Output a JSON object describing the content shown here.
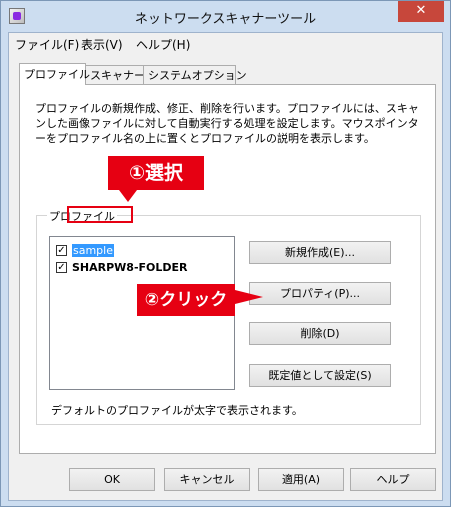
{
  "window": {
    "title": "ネットワークスキャナーツール",
    "close_label": "✕"
  },
  "menu": [
    "ファイル(F)",
    "表示(V)",
    "ヘルプ(H)"
  ],
  "tabs": [
    "プロファイル",
    "スキャナー",
    "システムオプション"
  ],
  "description": "プロファイルの新規作成、修正、削除を行います。プロファイルには、スキャンした画像ファイルに対して自動実行する処理を設定します。マウスポインターをプロファイル名の上に置くとプロファイルの説明を表示します。",
  "profile_group": {
    "label": "プロファイル",
    "items": [
      {
        "name": "sample",
        "checked": true,
        "selected": true,
        "bold": false
      },
      {
        "name": "SHARPW8-FOLDER",
        "checked": true,
        "selected": false,
        "bold": true
      }
    ],
    "buttons": {
      "new": "新規作成(E)...",
      "properties": "プロパティ(P)...",
      "delete": "削除(D)",
      "set_default": "既定値として設定(S)"
    },
    "footnote": "デフォルトのプロファイルが太字で表示されます。"
  },
  "dialog_buttons": {
    "ok": "OK",
    "cancel": "キャンセル",
    "apply": "適用(A)",
    "help": "ヘルプ"
  },
  "annotations": {
    "select": "①選択",
    "click": "②クリック"
  },
  "colors": {
    "accent_red": "#e60012",
    "selection_blue": "#3399ff",
    "window_frame": "#ccddf0"
  }
}
